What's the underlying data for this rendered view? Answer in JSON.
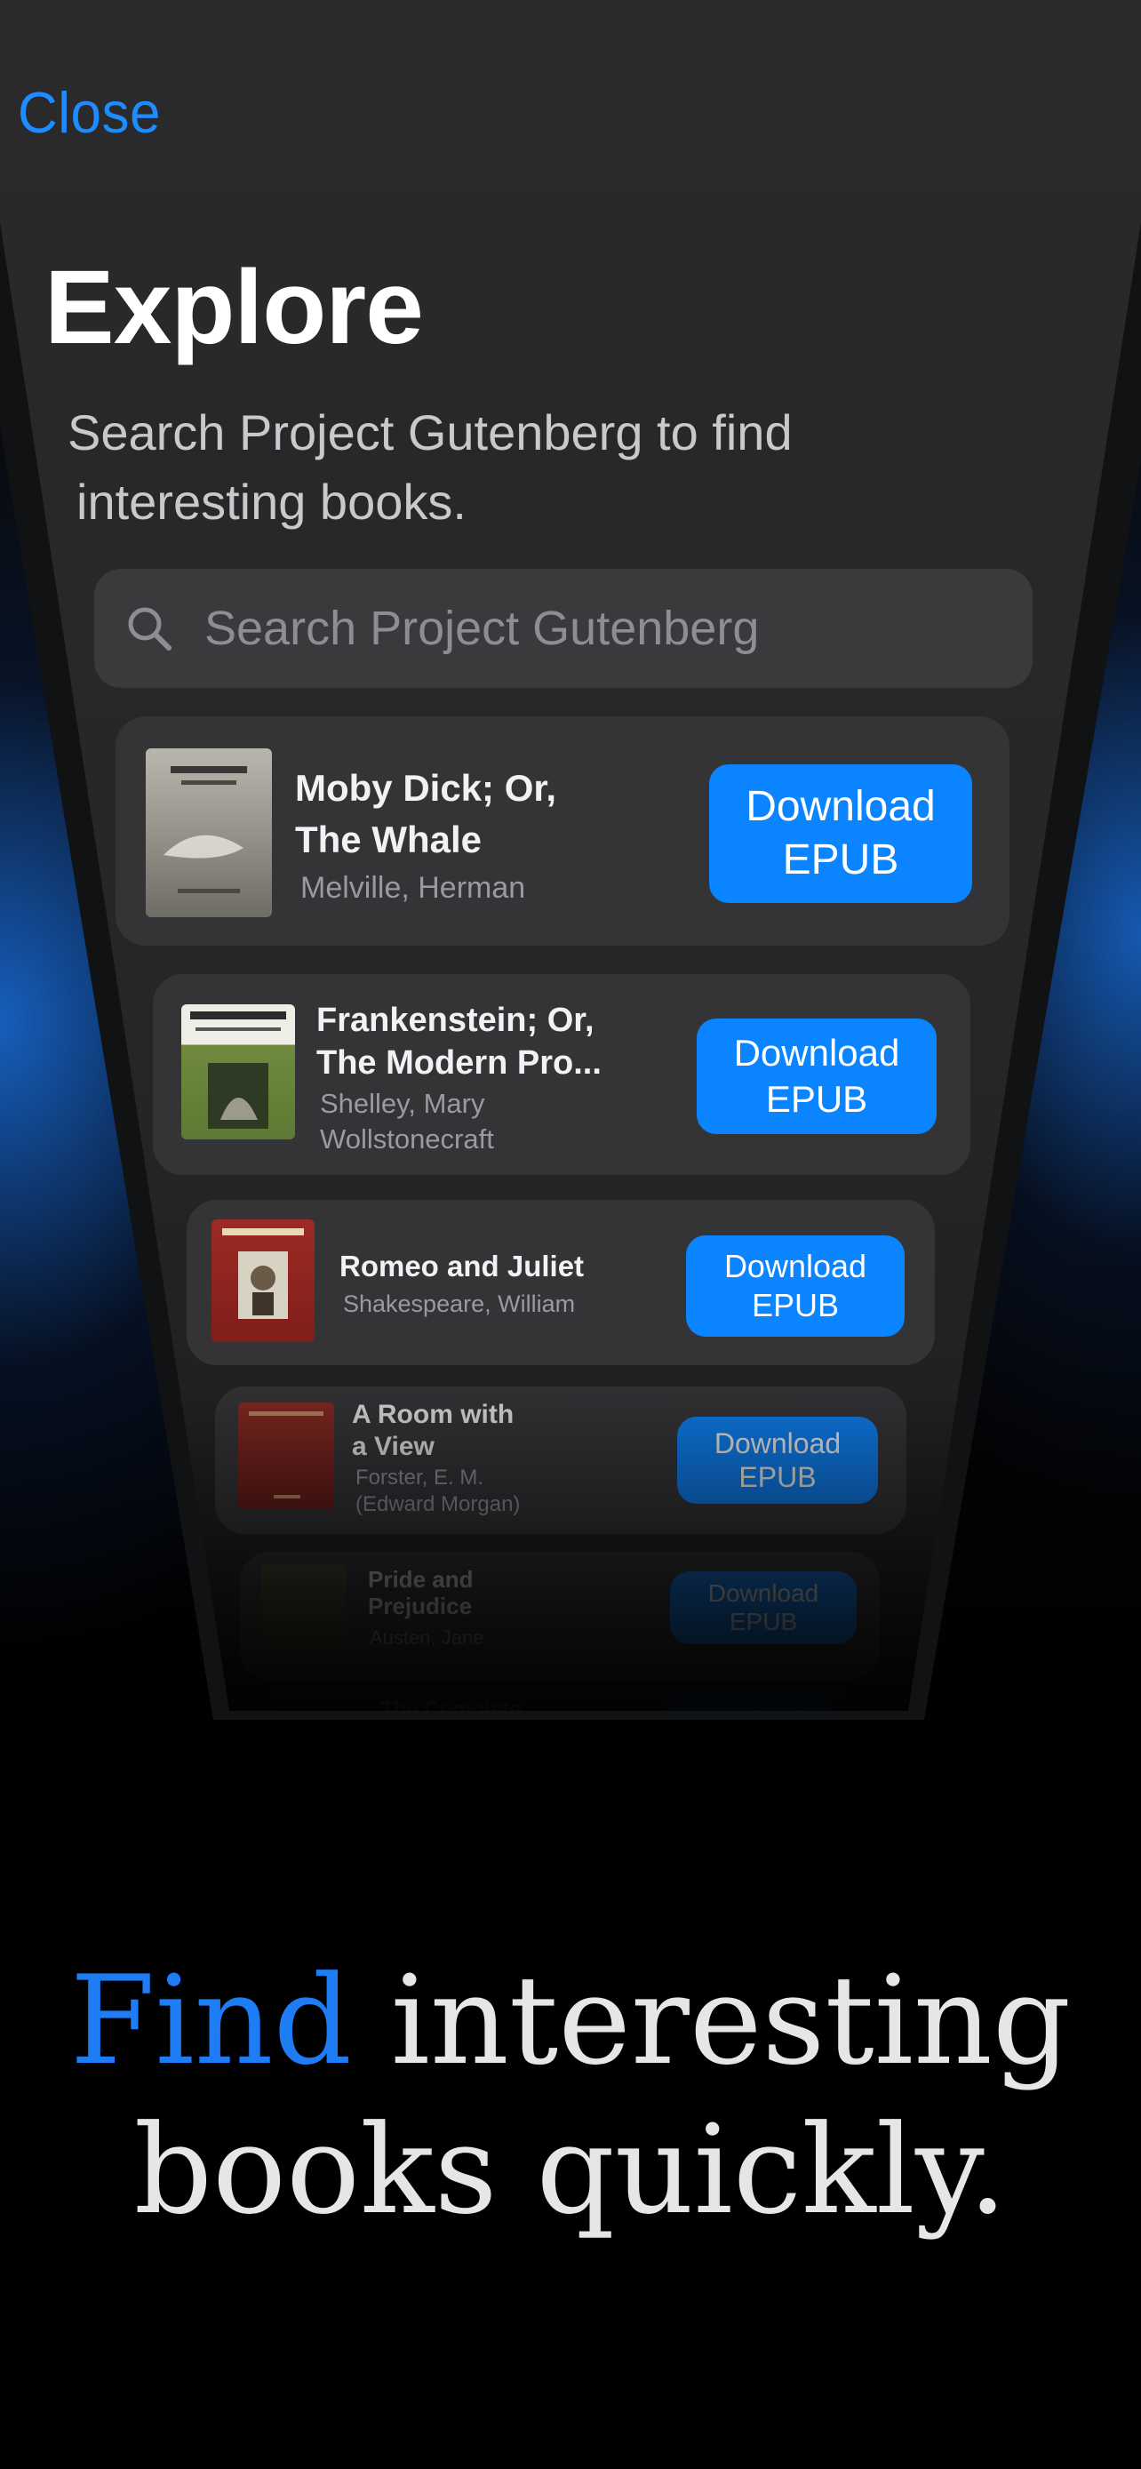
{
  "nav": {
    "close_label": "Close"
  },
  "header": {
    "title": "Explore",
    "subtitle_line1": "Search Project Gutenberg to find",
    "subtitle_line2": "interesting books."
  },
  "search": {
    "placeholder": "Search Project Gutenberg"
  },
  "books": [
    {
      "title_line1": "Moby Dick; Or,",
      "title_line2": "The Whale",
      "author_line1": "Melville, Herman",
      "author_line2": "",
      "button_line1": "Download",
      "button_line2": "EPUB"
    },
    {
      "title_line1": "Frankenstein; Or,",
      "title_line2": "The Modern Pro...",
      "author_line1": "Shelley, Mary",
      "author_line2": "Wollstonecraft",
      "button_line1": "Download",
      "button_line2": "EPUB"
    },
    {
      "title_line1": "Romeo and Juliet",
      "title_line2": "",
      "author_line1": "Shakespeare, William",
      "author_line2": "",
      "button_line1": "Download",
      "button_line2": "EPUB"
    },
    {
      "title_line1": "A Room with",
      "title_line2": "a View",
      "author_line1": "Forster, E. M.",
      "author_line2": "(Edward Morgan)",
      "button_line1": "Download",
      "button_line2": "EPUB"
    },
    {
      "title_line1": "Pride and",
      "title_line2": "Prejudice",
      "author_line1": "Austen, Jane",
      "author_line2": "",
      "button_line1": "Download",
      "button_line2": "EPUB"
    },
    {
      "title_line1": "The Complete",
      "title_line2": "",
      "author_line1": "",
      "author_line2": "",
      "button_line1": "Download",
      "button_line2": ""
    }
  ],
  "tagline": {
    "highlight": "Find",
    "rest_line1": " interesting",
    "line2": "books quickly."
  },
  "colors": {
    "accent": "#0a84ff",
    "background": "#000000",
    "card": "#343437"
  }
}
